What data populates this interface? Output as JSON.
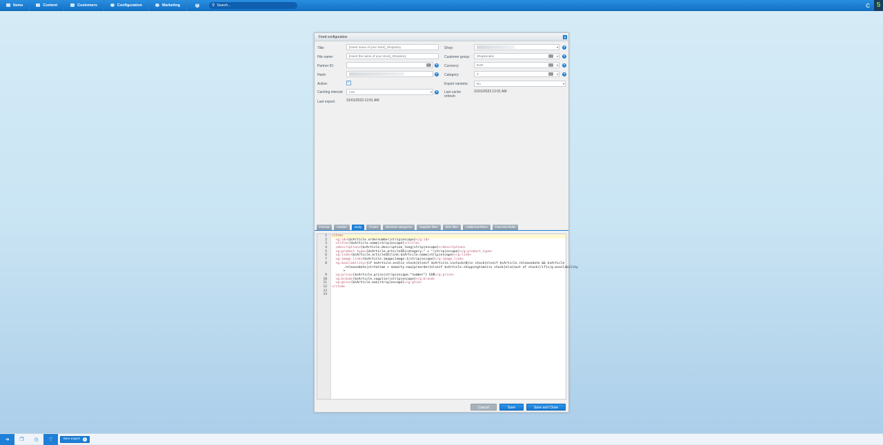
{
  "topbar": {
    "items": [
      {
        "label": "Items",
        "icon": "items-icon"
      },
      {
        "label": "Content",
        "icon": "content-icon"
      },
      {
        "label": "Customers",
        "icon": "customers-icon"
      },
      {
        "label": "Configuration",
        "icon": "gear-icon"
      },
      {
        "label": "Marketing",
        "icon": "marketing-icon"
      }
    ],
    "help": "?",
    "search_placeholder": "Search...",
    "logo": "5"
  },
  "dialog": {
    "title": "Feed configuration",
    "close": "x",
    "left": {
      "title_label": "Title:",
      "title_value": "[Insert name of your store]_Shopstory",
      "filename_label": "File name:",
      "filename_value": "[Insert the name of your store]_Shopstory",
      "partner_label": "Partner ID:",
      "partner_value": "",
      "hash_label": "Hash:",
      "active_label": "Active:",
      "active_checked": true,
      "caching_label": "Caching interval:",
      "caching_value": "Live",
      "lastexport_label": "Last export:",
      "lastexport_value": "31/01/2023 12:01 AM"
    },
    "right": {
      "shop_label": "Shop:",
      "customergroup_label": "Customer group:",
      "customergroup_value": "Shopkunden",
      "currency_label": "Currency:",
      "currency_value": "EUR",
      "category_label": "Category:",
      "category_value": "3",
      "variants_label": "Export variants:",
      "variants_value": "No",
      "cache_label": "Last cache refresh:",
      "cache_value": "31/01/2023 12:01 AM"
    },
    "tabs": [
      "Format",
      "Header",
      "Body",
      "Footer",
      "Blocked categories",
      "Supplier filter",
      "Item filter",
      "Additional filters",
      "Free text fields"
    ],
    "active_tab": "Body",
    "code_lines": [
      "<item>",
      "  <g:id>{$sArticle.ordernumber|strip|escape}</g:id>",
      "  <title>{$sArticle.name|strip|escape}</title>",
      "  <description>{$sArticle.description_long|strip|escape}</description>",
      "  <g:product_type>{$sArticle.articleID|category:\" > \"|strip|escape}</g:product_type>",
      "  <g:link>{$sArticle.articleID|link:$sArticle.name|strip|escape}</g:link>",
      "  <g:image_link>{$sArticle.image|image:1|strip|escape}</g:image_link>",
      "  <g:availability>{if $sArticle.esd}in stock{elseif $sArticle.instock>0}in stock{elseif $sArticle.releasedate && $sArticle",
      "      .releasedate|strtotime > $smarty.now}preorder{elseif $sArticle.shippingtime}in stock{else}out of stock{/if}</g:availability",
      "      >",
      "  <g:price>{$sArticle.price|strip|escape:\"number\"} EUR</g:price>",
      "  <g:brand>{$sArticle.supplier|strip|escape}</g:brand>",
      "  <g:gtin>{$sArticle.ean|strip|escape}</g:gtin>",
      "</item>",
      "",
      ""
    ],
    "line_numbers": [
      "1",
      "2",
      "3",
      "4",
      "5",
      "6",
      "7",
      "8",
      "",
      "",
      "9",
      "10",
      "11",
      "12",
      "13",
      "14"
    ],
    "buttons": {
      "cancel": "Cancel",
      "save": "Save",
      "save_close": "Save and Close"
    }
  },
  "taskbar": {
    "chip": "Item export"
  }
}
